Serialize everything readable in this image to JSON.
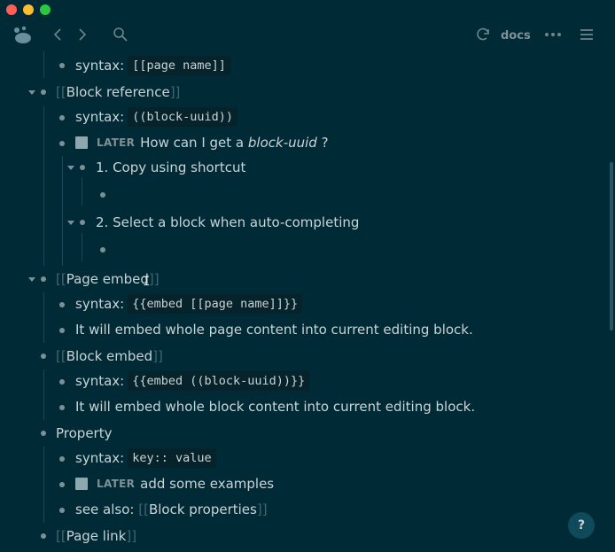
{
  "titlebar": {
    "dot_colors": [
      "#ff5f57",
      "#febc2e",
      "#28c840"
    ]
  },
  "toolbar": {
    "left_icons": [
      "logseq-logo-icon",
      "back-icon",
      "forward-icon",
      "search-icon"
    ],
    "right_icons": [
      "sync-icon",
      "more-icon",
      "menu-icon"
    ],
    "repo_label": "docs"
  },
  "blocks": {
    "b1": {
      "prefix": "syntax:",
      "code": "[[page name]]"
    },
    "b2": {
      "title": "Block reference"
    },
    "b3": {
      "prefix": "syntax:",
      "code": "((block-uuid))"
    },
    "b4": {
      "marker": "LATER",
      "text1": "How can I get a ",
      "italic": "block-uuid",
      "text2": " ?"
    },
    "b5": {
      "text": "1. Copy using shortcut"
    },
    "b6": {
      "text": "2. Select a block when auto-completing"
    },
    "b7": {
      "title": "Page embed"
    },
    "b8": {
      "prefix": "syntax:",
      "code": "{{embed [[page name]]}}"
    },
    "b9": {
      "text": "It will embed whole page content into current editing block."
    },
    "b10": {
      "title": "Block embed"
    },
    "b11": {
      "prefix": "syntax:",
      "code": "{{embed ((block-uuid))}}"
    },
    "b12": {
      "text": "It will embed whole block content into current editing block."
    },
    "b13": {
      "text": "Property"
    },
    "b14": {
      "prefix": "syntax:",
      "code": "key:: value"
    },
    "b15": {
      "marker": "LATER",
      "text": "add some examples"
    },
    "b16": {
      "prefix": "see also:",
      "link": "Block properties"
    },
    "b17": {
      "title": "Page link"
    }
  },
  "brackets": {
    "open": "[[",
    "close": "]]"
  },
  "help_button": {
    "label": "?"
  }
}
